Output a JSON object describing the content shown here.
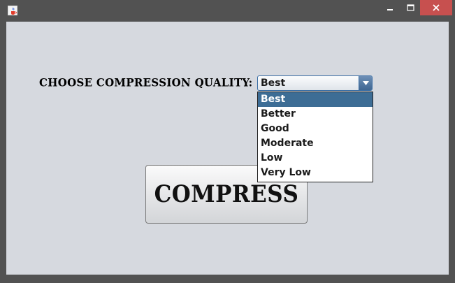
{
  "window": {
    "title": "",
    "icons": {
      "app": "java-cup-icon",
      "minimize": "minimize-icon",
      "maximize": "maximize-icon",
      "close": "close-icon"
    },
    "colors": {
      "titlebar": "#525252",
      "close_button": "#c7504f",
      "content_bg": "#d6d9df",
      "selection": "#3d6d95"
    }
  },
  "form": {
    "quality_label": "CHOOSE COMPRESSION QUALITY:",
    "quality_select": {
      "selected": "Best",
      "options": [
        "Best",
        "Better",
        "Good",
        "Moderate",
        "Low",
        "Very Low"
      ],
      "highlighted_index": 0
    },
    "compress_label": "COMPRESS"
  }
}
